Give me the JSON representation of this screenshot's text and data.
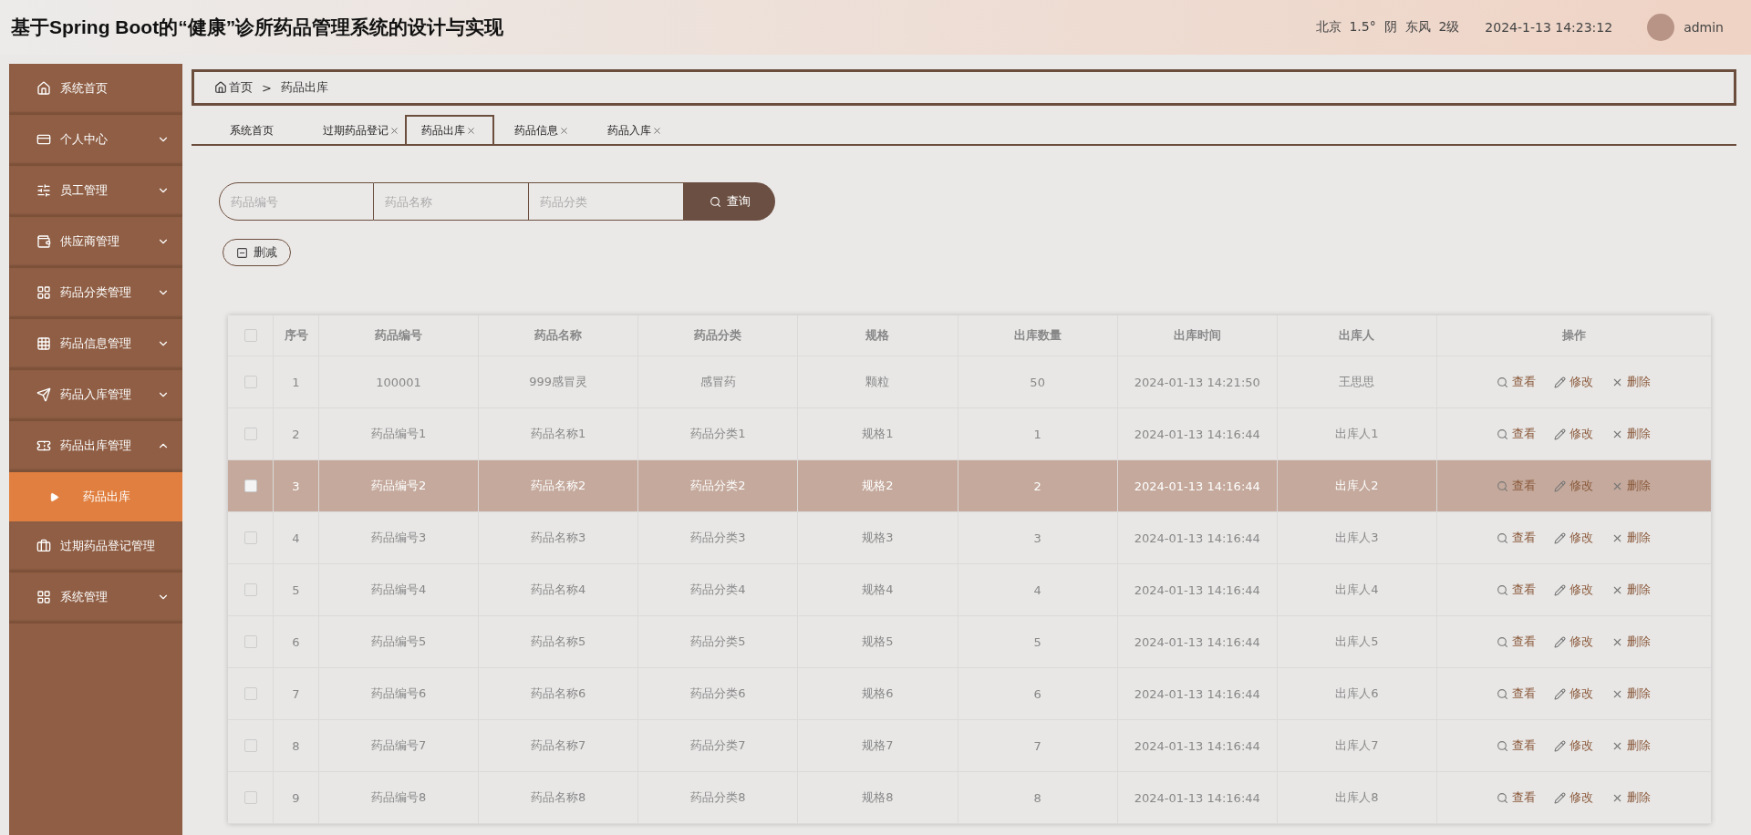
{
  "header": {
    "title": "基于Spring Boot的“健康”诊所药品管理系统的设计与实现",
    "weather": "北京  1.5°  阴  东风  2级",
    "datetime": "2024-1-13 14:23:12",
    "user": "admin"
  },
  "sidebar": {
    "items": [
      {
        "label": "系统首页",
        "kind": "link"
      },
      {
        "label": "个人中心",
        "kind": "group",
        "expanded": false
      },
      {
        "label": "员工管理",
        "kind": "group",
        "expanded": false
      },
      {
        "label": "供应商管理",
        "kind": "group",
        "expanded": false
      },
      {
        "label": "药品分类管理",
        "kind": "group",
        "expanded": false
      },
      {
        "label": "药品信息管理",
        "kind": "group",
        "expanded": false
      },
      {
        "label": "药品入库管理",
        "kind": "group",
        "expanded": false
      },
      {
        "label": "药品出库管理",
        "kind": "group",
        "expanded": true,
        "children": [
          {
            "label": "药品出库",
            "selected": true
          }
        ]
      },
      {
        "label": "过期药品登记管理",
        "kind": "link"
      },
      {
        "label": "系统管理",
        "kind": "group",
        "expanded": false
      }
    ]
  },
  "breadcrumb": {
    "home": "首页",
    "separator": ">",
    "current": "药品出库"
  },
  "tabs": [
    {
      "label": "系统首页",
      "selected": false,
      "closable": false
    },
    {
      "label": "过期药品登记",
      "selected": false,
      "closable": true
    },
    {
      "label": "药品出库",
      "selected": true,
      "closable": true
    },
    {
      "label": "药品信息",
      "selected": false,
      "closable": true
    },
    {
      "label": "药品入库",
      "selected": false,
      "closable": true
    }
  ],
  "search": {
    "fields": [
      {
        "placeholder": "药品编号"
      },
      {
        "placeholder": "药品名称"
      },
      {
        "placeholder": "药品分类"
      }
    ],
    "button": "查询"
  },
  "toolbar": {
    "delete_button": "删减"
  },
  "table": {
    "select_all_checked": false,
    "columns": [
      "序号",
      "药品编号",
      "药品名称",
      "药品分类",
      "规格",
      "出库数量",
      "出库时间",
      "出库人",
      "操作"
    ],
    "rows": [
      {
        "cells": [
          "1",
          "100001",
          "999感冒灵",
          "感冒药",
          "颗粒",
          "50",
          "2024-01-13 14:21:50",
          "王思思"
        ],
        "actions": [
          "查看",
          "修改",
          "删除"
        ],
        "checked": false,
        "selected": false
      },
      {
        "cells": [
          "2",
          "药品编号1",
          "药品名称1",
          "药品分类1",
          "规格1",
          "1",
          "2024-01-13 14:16:44",
          "出库人1"
        ],
        "actions": [
          "查看",
          "修改",
          "删除"
        ],
        "checked": false,
        "selected": false
      },
      {
        "cells": [
          "3",
          "药品编号2",
          "药品名称2",
          "药品分类2",
          "规格2",
          "2",
          "2024-01-13 14:16:44",
          "出库人2"
        ],
        "actions": [
          "查看",
          "修改",
          "删除"
        ],
        "checked": false,
        "selected": true
      },
      {
        "cells": [
          "4",
          "药品编号3",
          "药品名称3",
          "药品分类3",
          "规格3",
          "3",
          "2024-01-13 14:16:44",
          "出库人3"
        ],
        "actions": [
          "查看",
          "修改",
          "删除"
        ],
        "checked": false,
        "selected": false
      },
      {
        "cells": [
          "5",
          "药品编号4",
          "药品名称4",
          "药品分类4",
          "规格4",
          "4",
          "2024-01-13 14:16:44",
          "出库人4"
        ],
        "actions": [
          "查看",
          "修改",
          "删除"
        ],
        "checked": false,
        "selected": false
      },
      {
        "cells": [
          "6",
          "药品编号5",
          "药品名称5",
          "药品分类5",
          "规格5",
          "5",
          "2024-01-13 14:16:44",
          "出库人5"
        ],
        "actions": [
          "查看",
          "修改",
          "删除"
        ],
        "checked": false,
        "selected": false
      },
      {
        "cells": [
          "7",
          "药品编号6",
          "药品名称6",
          "药品分类6",
          "规格6",
          "6",
          "2024-01-13 14:16:44",
          "出库人6"
        ],
        "actions": [
          "查看",
          "修改",
          "删除"
        ],
        "checked": false,
        "selected": false
      },
      {
        "cells": [
          "8",
          "药品编号7",
          "药品名称7",
          "药品分类7",
          "规格7",
          "7",
          "2024-01-13 14:16:44",
          "出库人7"
        ],
        "actions": [
          "查看",
          "修改",
          "删除"
        ],
        "checked": false,
        "selected": false
      },
      {
        "cells": [
          "9",
          "药品编号8",
          "药品名称8",
          "药品分类8",
          "规格8",
          "8",
          "2024-01-13 14:16:44",
          "出库人8"
        ],
        "actions": [
          "查看",
          "修改",
          "删除"
        ],
        "checked": false,
        "selected": false
      }
    ]
  }
}
